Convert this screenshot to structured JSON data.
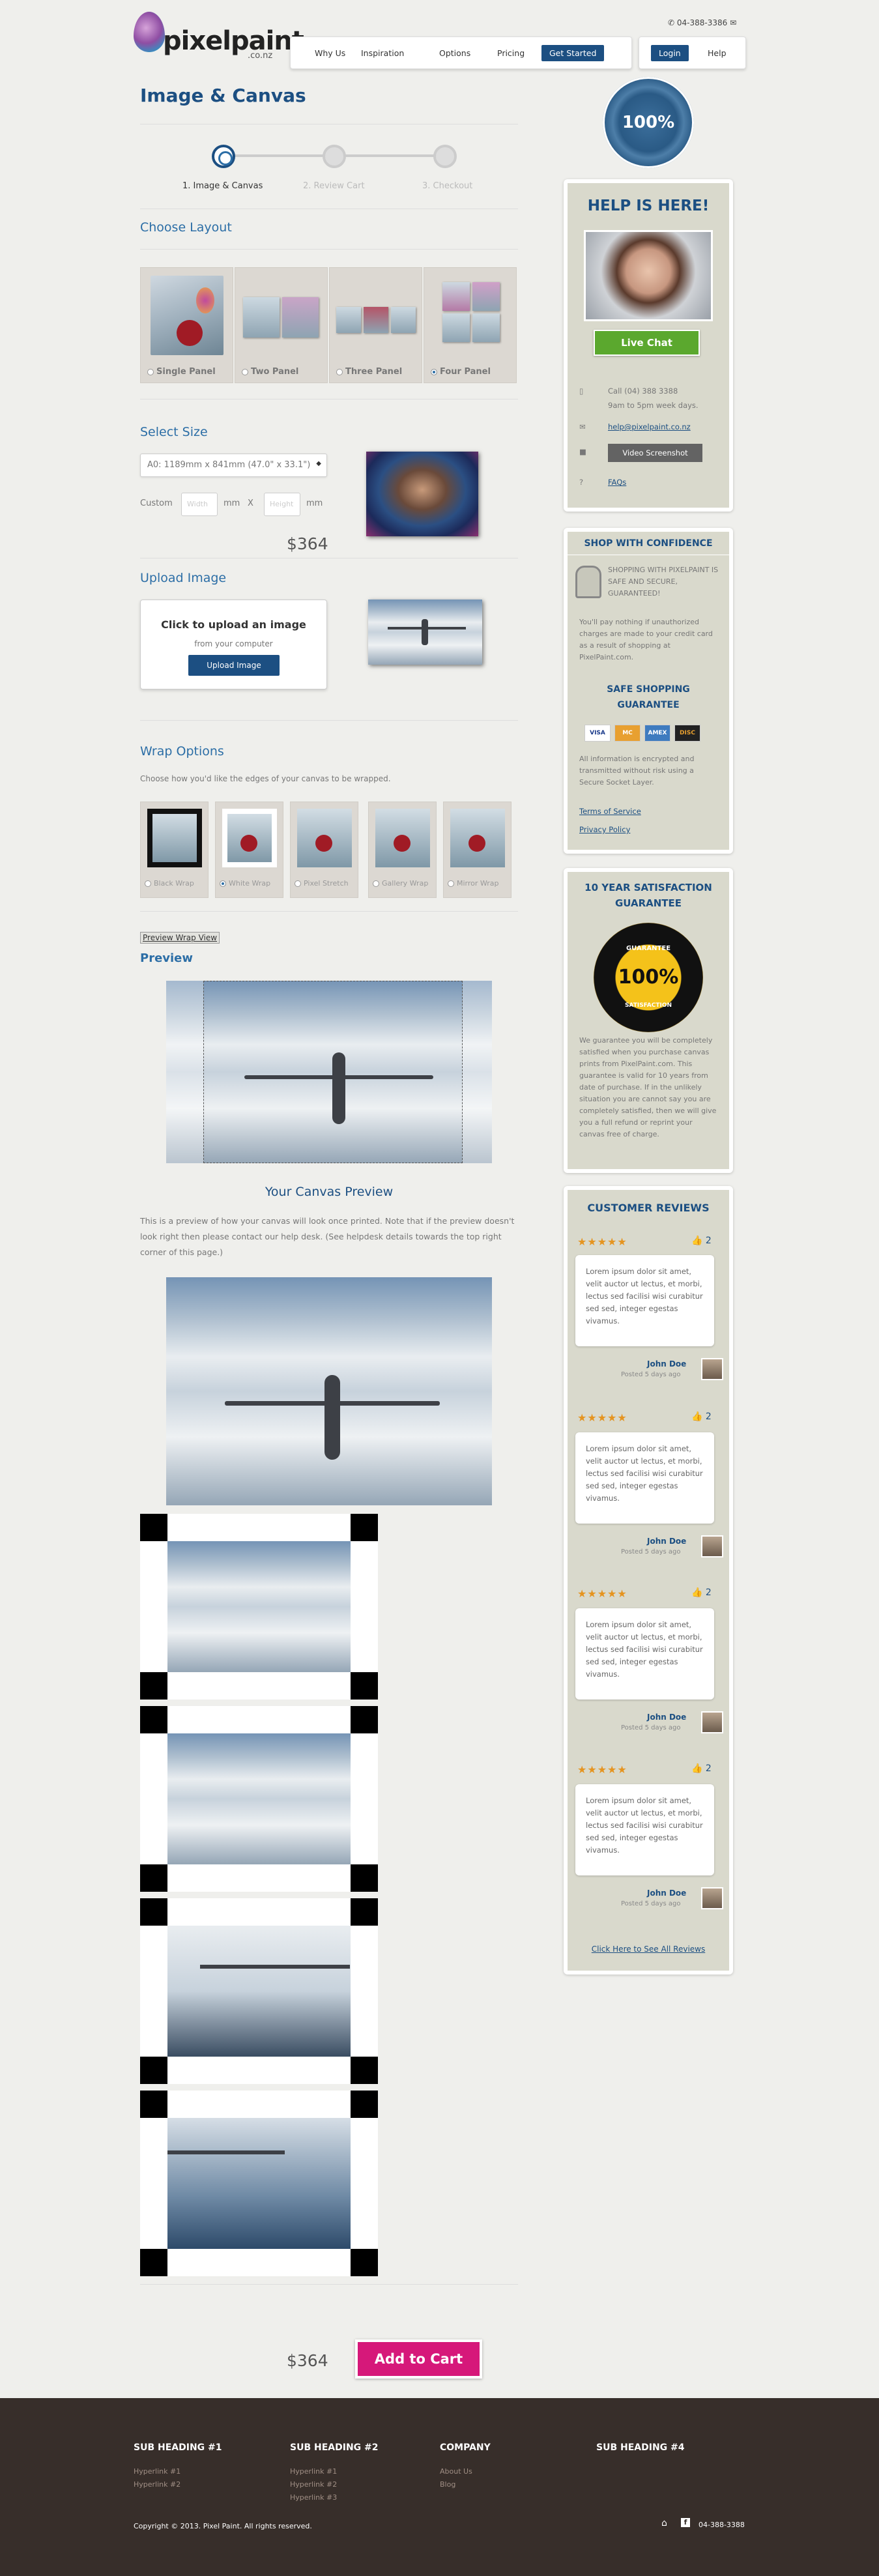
{
  "header": {
    "logo": "pixelpaint",
    "logo_sub": ".co.nz",
    "phone": "04-388-3386",
    "nav": [
      "Why Us",
      "Inspiration",
      "Options",
      "Pricing"
    ],
    "get_started": "Get Started",
    "login": "Login",
    "help": "Help"
  },
  "page_title": "Image & Canvas",
  "steps": [
    "1. Image & Canvas",
    "2. Review Cart",
    "3. Checkout"
  ],
  "layout": {
    "heading": "Choose Layout",
    "options": [
      "Single Panel",
      "Two Panel",
      "Three Panel",
      "Four Panel"
    ],
    "selected": "Four Panel"
  },
  "size": {
    "heading": "Select Size",
    "select_value": "A0: 1189mm x 841mm (47.0\" x 33.1\")",
    "custom_label": "Custom",
    "width_placeholder": "Width",
    "height_placeholder": "Height",
    "unit": "mm",
    "times": "X",
    "price": "$364"
  },
  "upload": {
    "heading": "Upload Image",
    "title": "Click to upload an image",
    "sub": "from your computer",
    "button": "Upload Image"
  },
  "wrap": {
    "heading": "Wrap Options",
    "desc": "Choose how you'd like the edges of your canvas to be wrapped.",
    "options": [
      "Black Wrap",
      "White Wrap",
      "Pixel Stretch",
      "Gallery Wrap",
      "Mirror Wrap"
    ],
    "selected": "White Wrap"
  },
  "preview": {
    "link": "Preview Wrap View",
    "heading": "Preview",
    "canvas_title": "Your Canvas Preview",
    "desc": "This is a preview of how your canvas will look once printed. Note that if the preview doesn't look right then please contact our help desk. (See helpdesk details towards the top right corner of this page.)"
  },
  "cart": {
    "price": "$364",
    "button": "Add to Cart"
  },
  "badge": {
    "text": "100%"
  },
  "help_box": {
    "heading": "HELP IS HERE!",
    "live_chat": "Live Chat",
    "call": "Call (04) 388 3388",
    "hours": "9am to 5pm week days.",
    "email": "help@pixelpaint.co.nz",
    "video": "Video Screenshot",
    "faqs": "FAQs"
  },
  "confidence": {
    "heading": "SHOP WITH CONFIDENCE",
    "secure": "SHOPPING WITH PIXELPAINT IS SAFE AND SECURE, GUARANTEED!",
    "pay_note": "You'll pay nothing if unauthorized charges are made to your credit card as a result of shopping at PixelPaint.com.",
    "safe_heading": "SAFE SHOPPING GUARANTEE",
    "cards": [
      "VISA",
      "MC",
      "AMEX",
      "DISC"
    ],
    "encrypt": "All information is encrypted and transmitted without risk using a Secure Socket Layer.",
    "terms": "Terms of Service",
    "privacy": "Privacy Policy"
  },
  "satisfaction": {
    "heading": "10 YEAR SATISFACTION GUARANTEE",
    "seal_top": "GUARANTEE",
    "seal_mid": "100%",
    "seal_bot": "SATISFACTION",
    "text": "We guarantee you will be completely satisfied when you purchase canvas prints from PixelPaint.com. This guarantee is valid for 10 years from date of purchase. If in the unlikely situation you are cannot say you are completely satisfied, then we will give you a full refund or reprint your canvas free of charge."
  },
  "reviews": {
    "heading": "CUSTOMER REVIEWS",
    "items": [
      {
        "likes": "2",
        "text": "Lorem ipsum dolor sit amet, velit auctor ut lectus, et morbi, lectus sed facilisi wisi curabitur sed sed, integer egestas vivamus.",
        "name": "John Doe",
        "posted": "Posted 5 days ago"
      },
      {
        "likes": "2",
        "text": "Lorem ipsum dolor sit amet, velit auctor ut lectus, et morbi, lectus sed facilisi wisi curabitur sed sed, integer egestas vivamus.",
        "name": "John Doe",
        "posted": "Posted 5 days ago"
      },
      {
        "likes": "2",
        "text": "Lorem ipsum dolor sit amet, velit auctor ut lectus, et morbi, lectus sed facilisi wisi curabitur sed sed, integer egestas vivamus.",
        "name": "John Doe",
        "posted": "Posted 5 days ago"
      },
      {
        "likes": "2",
        "text": "Lorem ipsum dolor sit amet, velit auctor ut lectus, et morbi, lectus sed facilisi wisi curabitur sed sed, integer egestas vivamus.",
        "name": "John Doe",
        "posted": "Posted 5 days ago"
      }
    ],
    "see_all": "Click Here to See All Reviews"
  },
  "footer": {
    "cols": [
      {
        "heading": "SUB HEADING #1",
        "links": [
          "Hyperlink #1",
          "Hyperlink #2"
        ]
      },
      {
        "heading": "SUB HEADING #2",
        "links": [
          "Hyperlink #1",
          "Hyperlink #2",
          "Hyperlink #3"
        ]
      },
      {
        "heading": "COMPANY",
        "links": [
          "About Us",
          "Blog"
        ]
      },
      {
        "heading": "SUB HEADING #4",
        "links": []
      }
    ],
    "copyright": "Copyright © 2013. Pixel Paint. All rights reserved.",
    "phone": "04-388-3388"
  }
}
